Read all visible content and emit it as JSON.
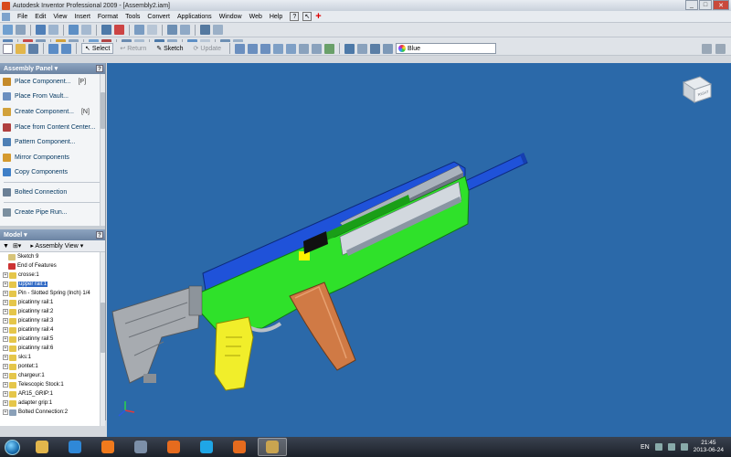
{
  "window": {
    "title": "Autodesk Inventor Professional 2009 - [Assembly2.iam]",
    "controls": [
      "_",
      "□",
      "✕"
    ]
  },
  "menubar": {
    "items": [
      "File",
      "Edit",
      "View",
      "Insert",
      "Format",
      "Tools",
      "Convert",
      "Applications",
      "Window",
      "Web",
      "Help"
    ]
  },
  "toolbar3": {
    "select_label": "Select",
    "return_label": "Return",
    "sketch_label": "Sketch",
    "update_label": "Update",
    "color_combo": "Blue"
  },
  "assembly_panel": {
    "title": "Assembly Panel",
    "commands": [
      {
        "label": "Place Component...",
        "shortcut": "[P]",
        "icon": "place-component-icon",
        "color": "#c58a2a"
      },
      {
        "label": "Place From Vault...",
        "shortcut": "",
        "icon": "vault-icon",
        "color": "#6b8fbf"
      },
      {
        "label": "Create Component...",
        "shortcut": "[N]",
        "icon": "create-component-icon",
        "color": "#d2a13a"
      },
      {
        "label": "Place from Content Center...",
        "shortcut": "",
        "icon": "content-center-icon",
        "color": "#b04040"
      },
      {
        "label": "Pattern Component...",
        "shortcut": "",
        "icon": "pattern-icon",
        "color": "#4d7fb5"
      },
      {
        "label": "Mirror Components",
        "shortcut": "",
        "icon": "mirror-icon",
        "color": "#d59a2e"
      },
      {
        "label": "Copy Components",
        "shortcut": "",
        "icon": "copy-icon",
        "color": "#3f7fc7"
      },
      {
        "label": "Bolted Connection",
        "shortcut": "",
        "icon": "bolt-icon",
        "color": "#6a7f95"
      },
      {
        "label": "Create Pipe Run...",
        "shortcut": "",
        "icon": "pipe-icon",
        "color": "#7b8f9f"
      }
    ]
  },
  "model_panel": {
    "title": "Model",
    "view_label": "Assembly View",
    "tree": [
      {
        "label": "Sketch 9",
        "pm": "",
        "indent": 1,
        "icon_color": "#d7c47a",
        "selected": false
      },
      {
        "label": "End of Features",
        "pm": "",
        "indent": 1,
        "icon_color": "#cc3333",
        "selected": false
      },
      {
        "label": "crosse:1",
        "pm": "+",
        "indent": 0,
        "icon_color": "#e5c64a",
        "selected": false
      },
      {
        "label": "upper rail:1",
        "pm": "+",
        "indent": 0,
        "icon_color": "#e5c64a",
        "selected": true
      },
      {
        "label": "Pin - Slotted Spring (Inch) 1/4",
        "pm": "+",
        "indent": 0,
        "icon_color": "#e5c64a",
        "selected": false
      },
      {
        "label": "picatinny rail:1",
        "pm": "+",
        "indent": 0,
        "icon_color": "#e5c64a",
        "selected": false
      },
      {
        "label": "picatinny rail:2",
        "pm": "+",
        "indent": 0,
        "icon_color": "#e5c64a",
        "selected": false
      },
      {
        "label": "picatinny rail:3",
        "pm": "+",
        "indent": 0,
        "icon_color": "#e5c64a",
        "selected": false
      },
      {
        "label": "picatinny rail:4",
        "pm": "+",
        "indent": 0,
        "icon_color": "#e5c64a",
        "selected": false
      },
      {
        "label": "picatinny rail:5",
        "pm": "+",
        "indent": 0,
        "icon_color": "#e5c64a",
        "selected": false
      },
      {
        "label": "picatinny rail:6",
        "pm": "+",
        "indent": 0,
        "icon_color": "#e5c64a",
        "selected": false
      },
      {
        "label": "sks:1",
        "pm": "+",
        "indent": 0,
        "icon_color": "#e5c64a",
        "selected": false
      },
      {
        "label": "pontet:1",
        "pm": "+",
        "indent": 0,
        "icon_color": "#e5c64a",
        "selected": false
      },
      {
        "label": "chargeur:1",
        "pm": "+",
        "indent": 0,
        "icon_color": "#e5c64a",
        "selected": false
      },
      {
        "label": "Telescopic Stock:1",
        "pm": "+",
        "indent": 0,
        "icon_color": "#e5c64a",
        "selected": false
      },
      {
        "label": "AR15_GRIP:1",
        "pm": "+",
        "indent": 0,
        "icon_color": "#e5c64a",
        "selected": false
      },
      {
        "label": "adapter grip:1",
        "pm": "+",
        "indent": 0,
        "icon_color": "#e5c64a",
        "selected": false
      },
      {
        "label": "Bolted Connection:2",
        "pm": "+",
        "indent": 0,
        "icon_color": "#8aa0b8",
        "selected": false
      }
    ]
  },
  "viewcube": {
    "face_label": "RIGHT"
  },
  "taskbar": {
    "apps": [
      {
        "name": "explorer-app",
        "color": "#e2b64c",
        "active": false
      },
      {
        "name": "ie-app",
        "color": "#2f88d8",
        "active": false
      },
      {
        "name": "media-player-app",
        "color": "#f07a1d",
        "active": false
      },
      {
        "name": "network-app",
        "color": "#7c8fa8",
        "active": false
      },
      {
        "name": "firefox-app",
        "color": "#e66b1e",
        "active": false
      },
      {
        "name": "skype-app",
        "color": "#1fa6e6",
        "active": false
      },
      {
        "name": "firefox-app-2",
        "color": "#e66b1e",
        "active": false
      },
      {
        "name": "inventor-app",
        "color": "#c9a450",
        "active": true
      }
    ],
    "language": "EN",
    "time": "21:45",
    "date": "2013-06-24"
  },
  "colors": {
    "viewport_bg": "#2b69a9",
    "green_body": "#2fe12a",
    "blue_parts": "#1f52d9",
    "stock_grey": "#a7abb0",
    "magazine_orange": "#d07a45",
    "grip_yellow": "#f1ee2a"
  }
}
